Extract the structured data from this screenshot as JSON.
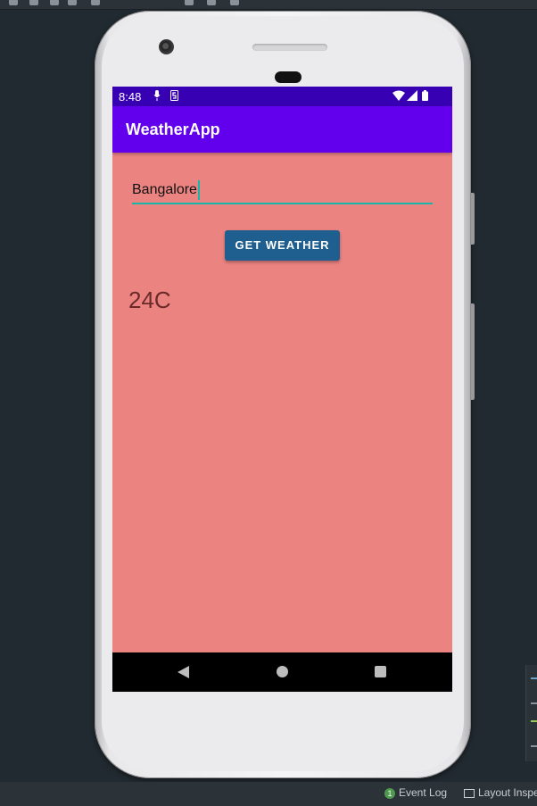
{
  "app": {
    "title": "WeatherApp",
    "status_time": "8:48",
    "city_value": "Bangalore",
    "button_label": "GET WEATHER",
    "temperature": "24C"
  },
  "ide": {
    "event_log_label": "Event Log",
    "event_log_count": "1",
    "layout_inspector_label": "Layout Inspe"
  },
  "colors": {
    "background": "#eb8381",
    "statusbar": "#3700b3",
    "appbar": "#6200ee",
    "button": "#1f5f8f",
    "input_underline": "#18b6a8"
  },
  "icons": {
    "status": [
      "mic-icon",
      "s-icon",
      "wifi-icon",
      "signal-icon",
      "battery-icon"
    ],
    "nav": [
      "back-icon",
      "home-icon",
      "recents-icon"
    ]
  }
}
